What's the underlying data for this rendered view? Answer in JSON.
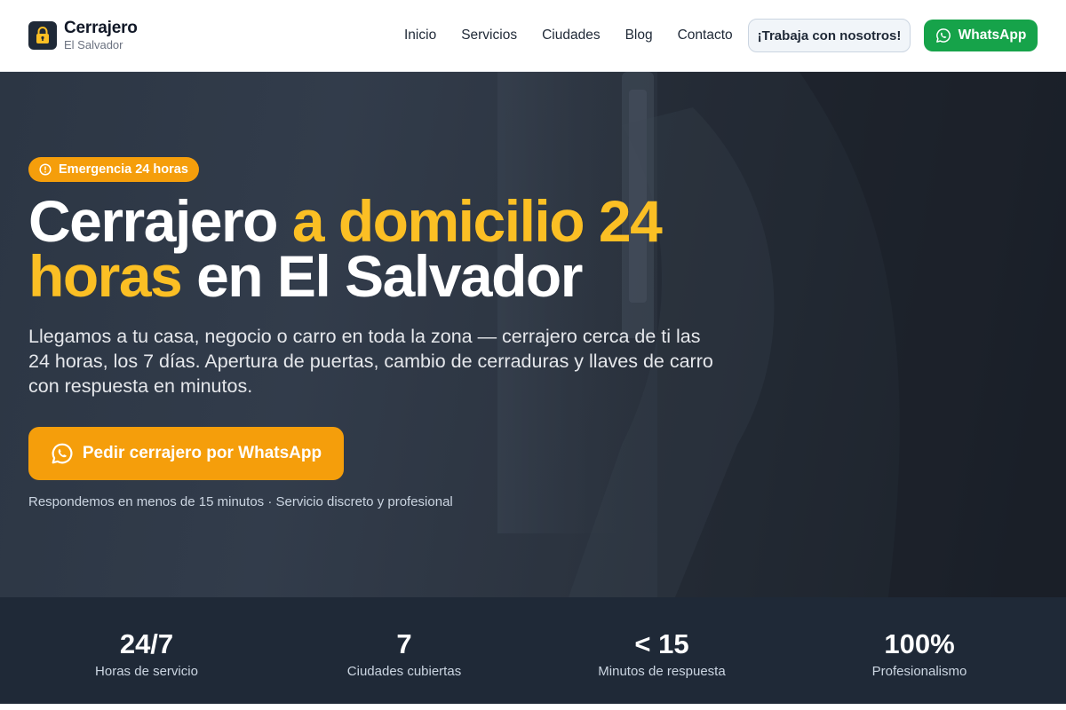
{
  "brand": {
    "name": "Cerrajero",
    "subtitle": "El Salvador",
    "icon": "padlock-icon",
    "icon_color": "#fbbf24"
  },
  "nav": {
    "items": [
      "Inicio",
      "Servicios",
      "Ciudades",
      "Blog",
      "Contacto"
    ]
  },
  "header": {
    "work_button": "¡Trabaja con nosotros!",
    "whatsapp_button": "WhatsApp"
  },
  "hero": {
    "badge": "Emergencia 24 horas",
    "title_part1": "Cerrajero ",
    "title_accent": "a domicilio 24 horas",
    "title_part2": " en El Salvador",
    "lead": "Llegamos a tu casa, negocio o carro en toda la zona — cerrajero cerca de ti las 24 horas, los 7 días. Apertura de puertas, cambio de cerraduras y llaves de carro con respuesta en minutos.",
    "cta": "Pedir cerrajero por WhatsApp",
    "note": "Respondemos en menos de 15 minutos · Servicio discreto y profesional"
  },
  "stats": [
    {
      "value": "24/7",
      "label": "Horas de servicio"
    },
    {
      "value": "7",
      "label": "Ciudades cubiertas"
    },
    {
      "value": "< 15",
      "label": "Minutos de respuesta"
    },
    {
      "value": "100%",
      "label": "Profesionalismo"
    }
  ],
  "colors": {
    "accent": "#f59e0b",
    "accent_text": "#fbbf24",
    "whatsapp": "#16a34a",
    "dark": "#1f2937"
  }
}
